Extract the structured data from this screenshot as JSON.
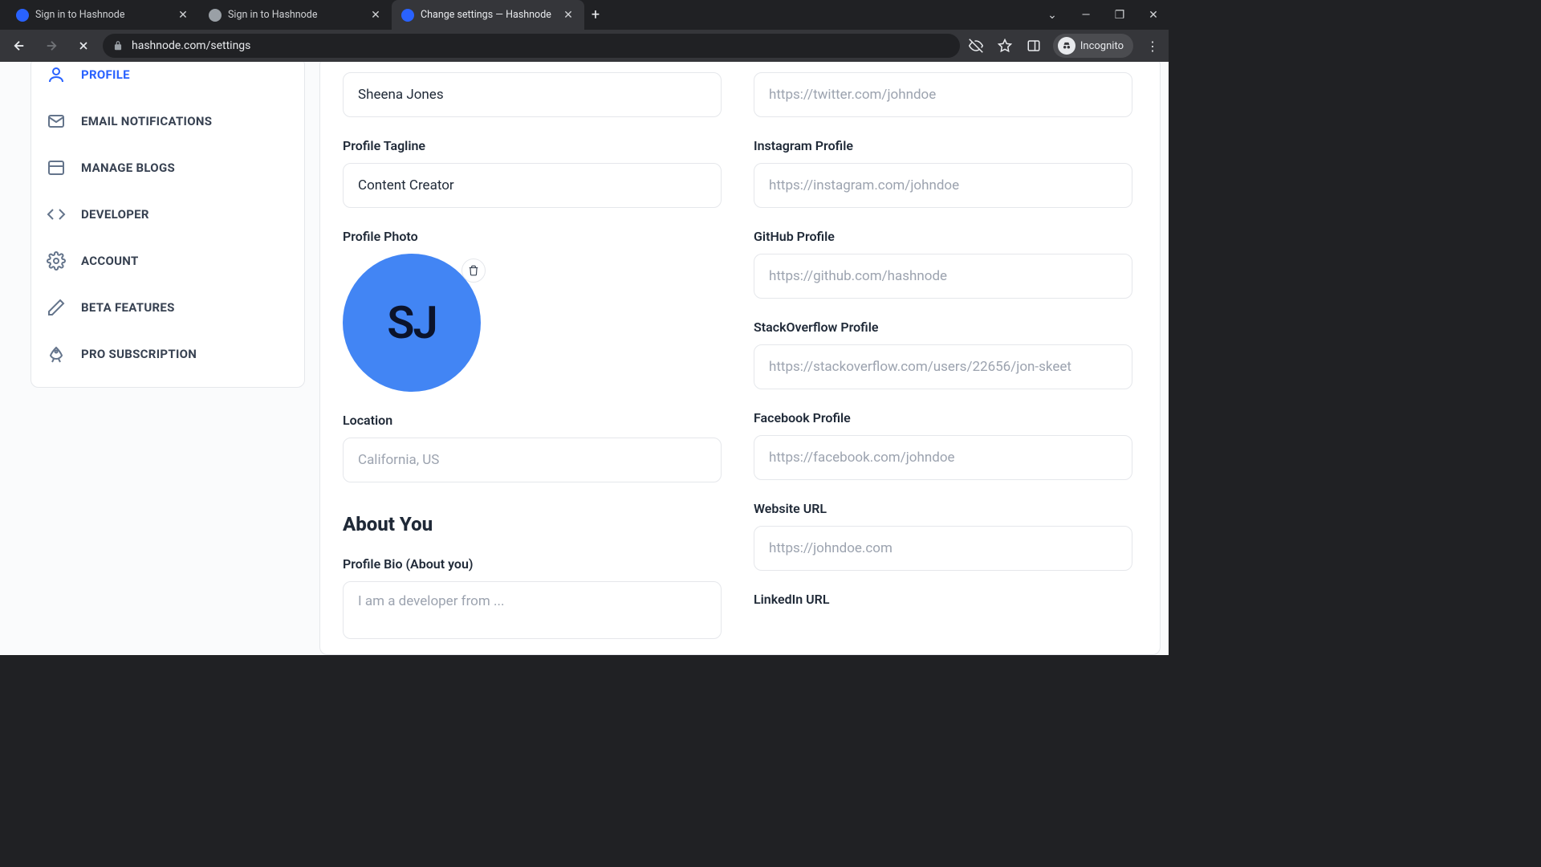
{
  "browser": {
    "tabs": [
      {
        "title": "Sign in to Hashnode",
        "favicon": "hn"
      },
      {
        "title": "Sign in to Hashnode",
        "favicon": "globe"
      },
      {
        "title": "Change settings — Hashnode",
        "favicon": "hn"
      }
    ],
    "url": "hashnode.com/settings",
    "incognito": "Incognito"
  },
  "sidebar": {
    "items": [
      {
        "label": "PROFILE"
      },
      {
        "label": "EMAIL NOTIFICATIONS"
      },
      {
        "label": "MANAGE BLOGS"
      },
      {
        "label": "DEVELOPER"
      },
      {
        "label": "ACCOUNT"
      },
      {
        "label": "BETA FEATURES"
      },
      {
        "label": "PRO SUBSCRIPTION"
      }
    ]
  },
  "form": {
    "name_value": "Sheena Jones",
    "tagline_label": "Profile Tagline",
    "tagline_value": "Content Creator",
    "photo_label": "Profile Photo",
    "avatar_initials": "SJ",
    "location_label": "Location",
    "location_placeholder": "California, US",
    "about_heading": "About You",
    "bio_label": "Profile Bio (About you)",
    "bio_placeholder": "I am a developer from ...",
    "twitter_placeholder": "https://twitter.com/johndoe",
    "instagram_label": "Instagram Profile",
    "instagram_placeholder": "https://instagram.com/johndoe",
    "github_label": "GitHub Profile",
    "github_placeholder": "https://github.com/hashnode",
    "so_label": "StackOverflow Profile",
    "so_placeholder": "https://stackoverflow.com/users/22656/jon-skeet",
    "facebook_label": "Facebook Profile",
    "facebook_placeholder": "https://facebook.com/johndoe",
    "website_label": "Website URL",
    "website_placeholder": "https://johndoe.com",
    "linkedin_label": "LinkedIn URL"
  }
}
